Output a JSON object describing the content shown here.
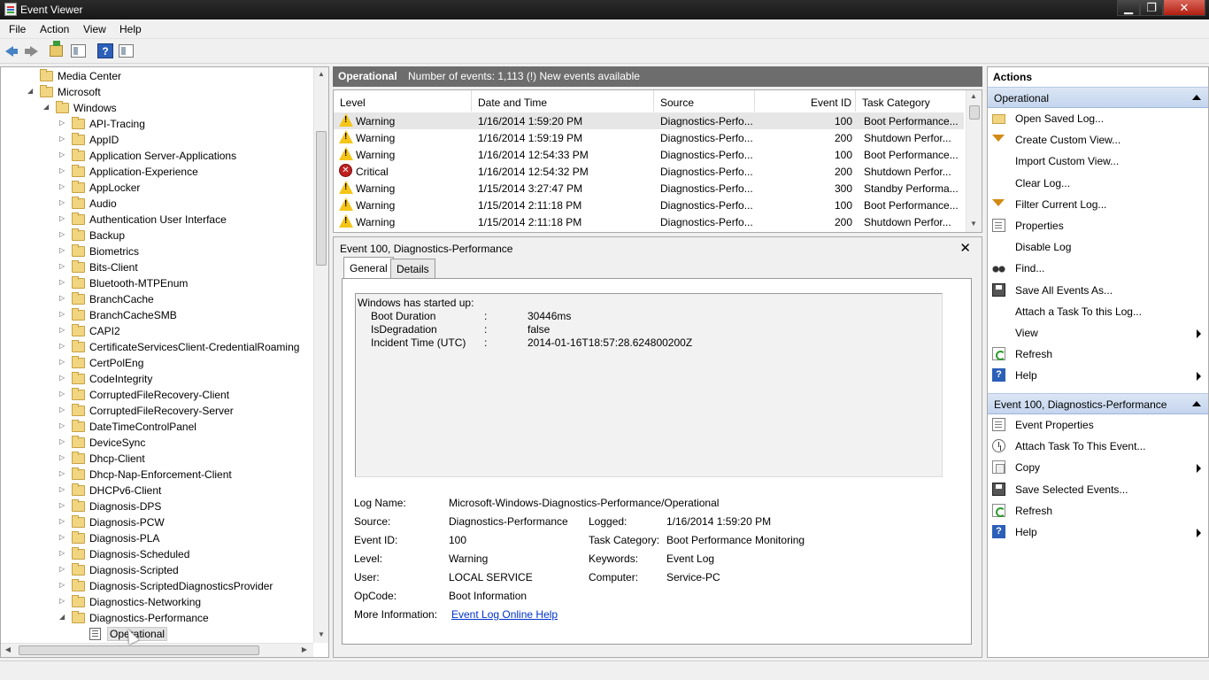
{
  "window": {
    "title": "Event Viewer",
    "min": "▁",
    "max": "❐",
    "close": "✕"
  },
  "menu": [
    "File",
    "Action",
    "View",
    "Help"
  ],
  "tree": {
    "items": [
      {
        "label": "Media Center",
        "exp": "",
        "level": 0
      },
      {
        "label": "Microsoft",
        "exp": "◢",
        "level": 0
      },
      {
        "label": "Windows",
        "exp": "◢",
        "level": 1
      },
      {
        "label": "API-Tracing",
        "exp": "▷",
        "level": 2
      },
      {
        "label": "AppID",
        "exp": "▷",
        "level": 2
      },
      {
        "label": "Application Server-Applications",
        "exp": "▷",
        "level": 2
      },
      {
        "label": "Application-Experience",
        "exp": "▷",
        "level": 2
      },
      {
        "label": "AppLocker",
        "exp": "▷",
        "level": 2
      },
      {
        "label": "Audio",
        "exp": "▷",
        "level": 2
      },
      {
        "label": "Authentication User Interface",
        "exp": "▷",
        "level": 2
      },
      {
        "label": "Backup",
        "exp": "▷",
        "level": 2
      },
      {
        "label": "Biometrics",
        "exp": "▷",
        "level": 2
      },
      {
        "label": "Bits-Client",
        "exp": "▷",
        "level": 2
      },
      {
        "label": "Bluetooth-MTPEnum",
        "exp": "▷",
        "level": 2
      },
      {
        "label": "BranchCache",
        "exp": "▷",
        "level": 2
      },
      {
        "label": "BranchCacheSMB",
        "exp": "▷",
        "level": 2
      },
      {
        "label": "CAPI2",
        "exp": "▷",
        "level": 2
      },
      {
        "label": "CertificateServicesClient-CredentialRoaming",
        "exp": "▷",
        "level": 2
      },
      {
        "label": "CertPolEng",
        "exp": "▷",
        "level": 2
      },
      {
        "label": "CodeIntegrity",
        "exp": "▷",
        "level": 2
      },
      {
        "label": "CorruptedFileRecovery-Client",
        "exp": "▷",
        "level": 2
      },
      {
        "label": "CorruptedFileRecovery-Server",
        "exp": "▷",
        "level": 2
      },
      {
        "label": "DateTimeControlPanel",
        "exp": "▷",
        "level": 2
      },
      {
        "label": "DeviceSync",
        "exp": "▷",
        "level": 2
      },
      {
        "label": "Dhcp-Client",
        "exp": "▷",
        "level": 2
      },
      {
        "label": "Dhcp-Nap-Enforcement-Client",
        "exp": "▷",
        "level": 2
      },
      {
        "label": "DHCPv6-Client",
        "exp": "▷",
        "level": 2
      },
      {
        "label": "Diagnosis-DPS",
        "exp": "▷",
        "level": 2
      },
      {
        "label": "Diagnosis-PCW",
        "exp": "▷",
        "level": 2
      },
      {
        "label": "Diagnosis-PLA",
        "exp": "▷",
        "level": 2
      },
      {
        "label": "Diagnosis-Scheduled",
        "exp": "▷",
        "level": 2
      },
      {
        "label": "Diagnosis-Scripted",
        "exp": "▷",
        "level": 2
      },
      {
        "label": "Diagnosis-ScriptedDiagnosticsProvider",
        "exp": "▷",
        "level": 2
      },
      {
        "label": "Diagnostics-Networking",
        "exp": "▷",
        "level": 2
      },
      {
        "label": "Diagnostics-Performance",
        "exp": "◢",
        "level": 2
      },
      {
        "label": "Operational",
        "exp": "",
        "level": 3,
        "log": true,
        "selected": true
      }
    ]
  },
  "log_header": {
    "name": "Operational",
    "summary": "Number of events: 1,113 (!) New events available"
  },
  "events": {
    "columns": [
      "Level",
      "Date and Time",
      "Source",
      "Event ID",
      "Task Category"
    ],
    "rows": [
      {
        "level": "Warning",
        "date": "1/16/2014 1:59:20 PM",
        "source": "Diagnostics-Perfo...",
        "id": "100",
        "task": "Boot Performance..."
      },
      {
        "level": "Warning",
        "date": "1/16/2014 1:59:19 PM",
        "source": "Diagnostics-Perfo...",
        "id": "200",
        "task": "Shutdown Perfor..."
      },
      {
        "level": "Warning",
        "date": "1/16/2014 12:54:33 PM",
        "source": "Diagnostics-Perfo...",
        "id": "100",
        "task": "Boot Performance..."
      },
      {
        "level": "Critical",
        "date": "1/16/2014 12:54:32 PM",
        "source": "Diagnostics-Perfo...",
        "id": "200",
        "task": "Shutdown Perfor..."
      },
      {
        "level": "Warning",
        "date": "1/15/2014 3:27:47 PM",
        "source": "Diagnostics-Perfo...",
        "id": "300",
        "task": "Standby Performa..."
      },
      {
        "level": "Warning",
        "date": "1/15/2014 2:11:18 PM",
        "source": "Diagnostics-Perfo...",
        "id": "100",
        "task": "Boot Performance..."
      },
      {
        "level": "Warning",
        "date": "1/15/2014 2:11:18 PM",
        "source": "Diagnostics-Perfo...",
        "id": "200",
        "task": "Shutdown Perfor..."
      }
    ]
  },
  "detail": {
    "title": "Event 100, Diagnostics-Performance",
    "close": "✕",
    "tabs": [
      "General",
      "Details"
    ],
    "description": {
      "intro": "Windows has started up:",
      "lines": [
        {
          "key": "Boot Duration",
          "sep": ":",
          "val": "30446ms"
        },
        {
          "key": "IsDegradation",
          "sep": ":",
          "val": "false"
        },
        {
          "key": "Incident Time (UTC)",
          "sep": ":",
          "val": "2014-01-16T18:57:28.624800200Z"
        }
      ]
    },
    "fields": {
      "log_name_label": "Log Name:",
      "log_name": "Microsoft-Windows-Diagnostics-Performance/Operational",
      "source_label": "Source:",
      "source": "Diagnostics-Performance",
      "logged_label": "Logged:",
      "logged": "1/16/2014 1:59:20 PM",
      "event_id_label": "Event ID:",
      "event_id": "100",
      "task_label": "Task Category:",
      "task": "Boot Performance Monitoring",
      "level_label": "Level:",
      "level": "Warning",
      "keywords_label": "Keywords:",
      "keywords": "Event Log",
      "user_label": "User:",
      "user": "LOCAL SERVICE",
      "computer_label": "Computer:",
      "computer": "Service-PC",
      "opcode_label": "OpCode:",
      "opcode": "Boot Information",
      "more_label": "More Information:",
      "more_link": "Event Log Online Help"
    }
  },
  "actions": {
    "title": "Actions",
    "section1": "Operational",
    "items1": [
      {
        "label": "Open Saved Log...",
        "icon": "folder-open-icon",
        "sub": false
      },
      {
        "label": "Create Custom View...",
        "icon": "filter-icon",
        "sub": false
      },
      {
        "label": "Import Custom View...",
        "icon": "",
        "sub": false
      },
      {
        "label": "Clear Log...",
        "icon": "",
        "sub": false
      },
      {
        "label": "Filter Current Log...",
        "icon": "filter-icon",
        "sub": false
      },
      {
        "label": "Properties",
        "icon": "properties-icon",
        "sub": false
      },
      {
        "label": "Disable Log",
        "icon": "",
        "sub": false
      },
      {
        "label": "Find...",
        "icon": "binoculars-icon",
        "sub": false
      },
      {
        "label": "Save All Events As...",
        "icon": "save-icon",
        "sub": false
      },
      {
        "label": "Attach a Task To this Log...",
        "icon": "",
        "sub": false
      },
      {
        "label": "View",
        "icon": "",
        "sub": true
      },
      {
        "label": "Refresh",
        "icon": "refresh-icon",
        "sub": false
      },
      {
        "label": "Help",
        "icon": "help-icon",
        "sub": true
      }
    ],
    "section2": "Event 100, Diagnostics-Performance",
    "items2": [
      {
        "label": "Event Properties",
        "icon": "properties-icon",
        "sub": false
      },
      {
        "label": "Attach Task To This Event...",
        "icon": "task-icon",
        "sub": false
      },
      {
        "label": "Copy",
        "icon": "copy-icon",
        "sub": true
      },
      {
        "label": "Save Selected Events...",
        "icon": "save-icon",
        "sub": false
      },
      {
        "label": "Refresh",
        "icon": "refresh-icon",
        "sub": false
      },
      {
        "label": "Help",
        "icon": "help-icon",
        "sub": true
      }
    ]
  }
}
